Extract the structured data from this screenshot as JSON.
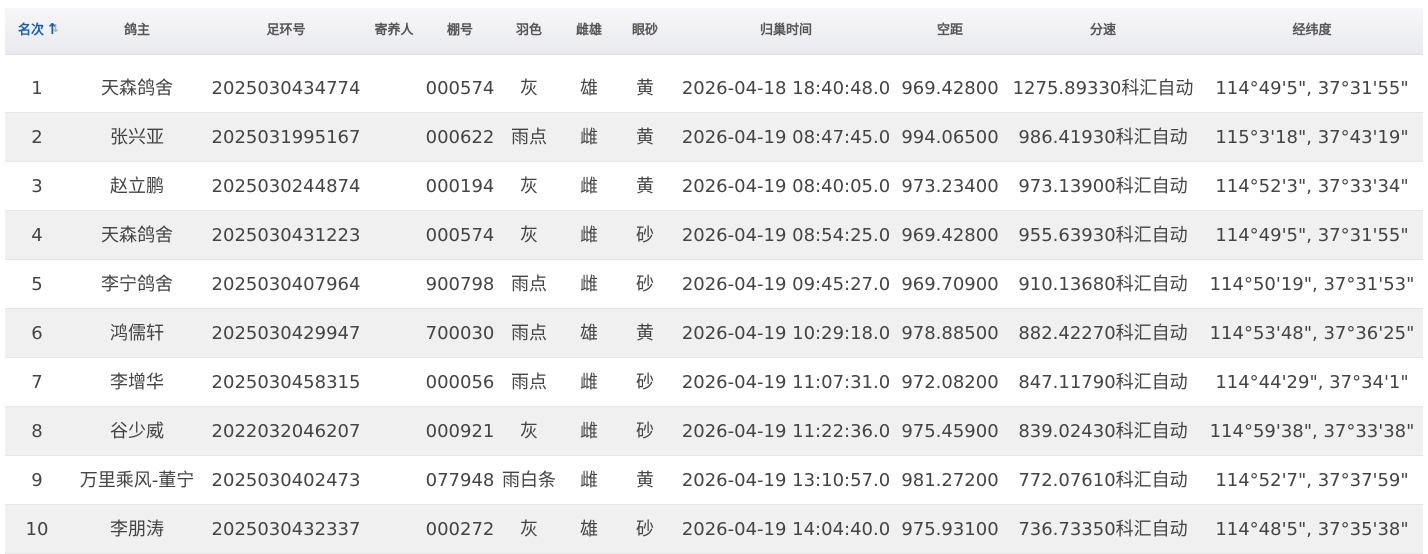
{
  "table": {
    "columns": [
      {
        "key": "rank",
        "label": "名次",
        "sorted": true
      },
      {
        "key": "owner",
        "label": "鸽主"
      },
      {
        "key": "ring",
        "label": "足环号"
      },
      {
        "key": "foster",
        "label": "寄养人"
      },
      {
        "key": "loft",
        "label": "棚号"
      },
      {
        "key": "color",
        "label": "羽色"
      },
      {
        "key": "sex",
        "label": "雌雄"
      },
      {
        "key": "eye",
        "label": "眼砂"
      },
      {
        "key": "arrival",
        "label": "归巢时间"
      },
      {
        "key": "distance",
        "label": "空距"
      },
      {
        "key": "speed",
        "label": "分速"
      },
      {
        "key": "coords",
        "label": "经纬度"
      }
    ],
    "sort_icon": "sort-ascending-icon",
    "rows": [
      {
        "rank": "1",
        "owner": "天森鸽舍",
        "ring": "2025030434774",
        "foster": "",
        "loft": "000574",
        "color": "灰",
        "sex": "雄",
        "eye": "黄",
        "arrival": "2026-04-18 18:40:48.0",
        "distance": "969.42800",
        "speed": "1275.89330科汇自动",
        "coords": "114°49'5\", 37°31'55\""
      },
      {
        "rank": "2",
        "owner": "张兴亚",
        "ring": "2025031995167",
        "foster": "",
        "loft": "000622",
        "color": "雨点",
        "sex": "雌",
        "eye": "黄",
        "arrival": "2026-04-19 08:47:45.0",
        "distance": "994.06500",
        "speed": "986.41930科汇自动",
        "coords": "115°3'18\", 37°43'19\""
      },
      {
        "rank": "3",
        "owner": "赵立鹏",
        "ring": "2025030244874",
        "foster": "",
        "loft": "000194",
        "color": "灰",
        "sex": "雌",
        "eye": "黄",
        "arrival": "2026-04-19 08:40:05.0",
        "distance": "973.23400",
        "speed": "973.13900科汇自动",
        "coords": "114°52'3\", 37°33'34\""
      },
      {
        "rank": "4",
        "owner": "天森鸽舍",
        "ring": "2025030431223",
        "foster": "",
        "loft": "000574",
        "color": "灰",
        "sex": "雌",
        "eye": "砂",
        "arrival": "2026-04-19 08:54:25.0",
        "distance": "969.42800",
        "speed": "955.63930科汇自动",
        "coords": "114°49'5\", 37°31'55\""
      },
      {
        "rank": "5",
        "owner": "李宁鸽舍",
        "ring": "2025030407964",
        "foster": "",
        "loft": "900798",
        "color": "雨点",
        "sex": "雌",
        "eye": "砂",
        "arrival": "2026-04-19 09:45:27.0",
        "distance": "969.70900",
        "speed": "910.13680科汇自动",
        "coords": "114°50'19\", 37°31'53\""
      },
      {
        "rank": "6",
        "owner": "鸿儒轩",
        "ring": "2025030429947",
        "foster": "",
        "loft": "700030",
        "color": "雨点",
        "sex": "雄",
        "eye": "黄",
        "arrival": "2026-04-19 10:29:18.0",
        "distance": "978.88500",
        "speed": "882.42270科汇自动",
        "coords": "114°53'48\", 37°36'25\""
      },
      {
        "rank": "7",
        "owner": "李增华",
        "ring": "2025030458315",
        "foster": "",
        "loft": "000056",
        "color": "雨点",
        "sex": "雌",
        "eye": "砂",
        "arrival": "2026-04-19 11:07:31.0",
        "distance": "972.08200",
        "speed": "847.11790科汇自动",
        "coords": "114°44'29\", 37°34'1\""
      },
      {
        "rank": "8",
        "owner": "谷少威",
        "ring": "2022032046207",
        "foster": "",
        "loft": "000921",
        "color": "灰",
        "sex": "雌",
        "eye": "砂",
        "arrival": "2026-04-19 11:22:36.0",
        "distance": "975.45900",
        "speed": "839.02430科汇自动",
        "coords": "114°59'38\", 37°33'38\""
      },
      {
        "rank": "9",
        "owner": "万里乘风-董宁",
        "ring": "2025030402473",
        "foster": "",
        "loft": "077948",
        "color": "雨白条",
        "sex": "雌",
        "eye": "黄",
        "arrival": "2026-04-19 13:10:57.0",
        "distance": "981.27200",
        "speed": "772.07610科汇自动",
        "coords": "114°52'7\", 37°37'59\""
      },
      {
        "rank": "10",
        "owner": "李朋涛",
        "ring": "2025030432337",
        "foster": "",
        "loft": "000272",
        "color": "灰",
        "sex": "雄",
        "eye": "砂",
        "arrival": "2026-04-19 14:04:40.0",
        "distance": "975.93100",
        "speed": "736.73350科汇自动",
        "coords": "114°48'5\", 37°35'38\""
      }
    ]
  }
}
